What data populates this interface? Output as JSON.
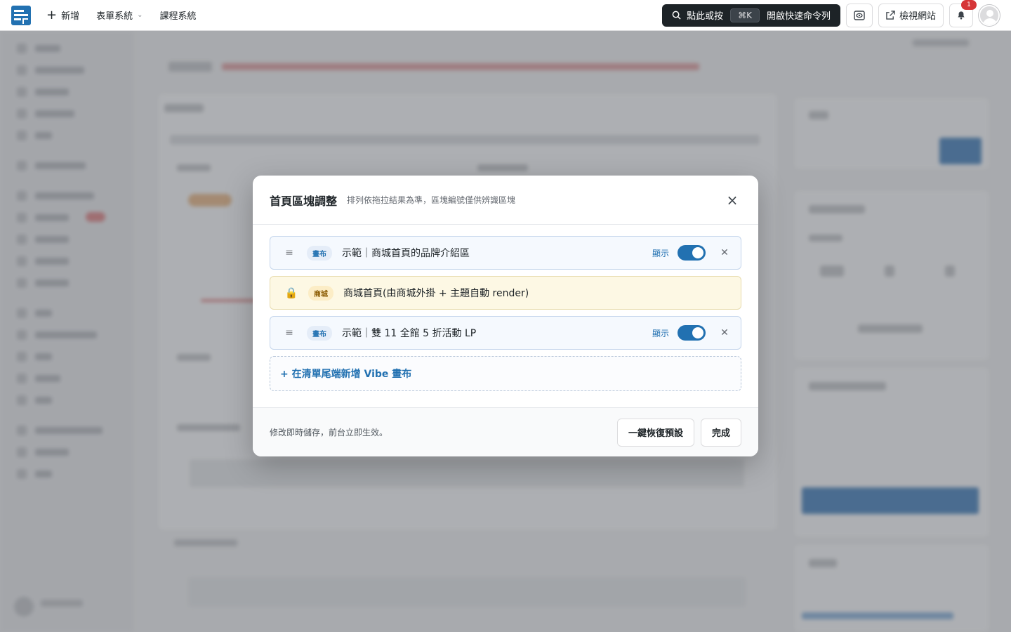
{
  "topbar": {
    "new_label": "新增",
    "forms_label": "表單系統",
    "courses_label": "課程系統",
    "command": {
      "prefix": "點此或按",
      "shortcut": "⌘K",
      "suffix": "開啟快速命令列"
    },
    "view_site_label": "檢視網站",
    "notification_count": "1"
  },
  "modal": {
    "title": "首頁區塊調整",
    "subtitle": "排列依拖拉結果為準，區塊編號僅供辨識區塊",
    "close_icon": "×",
    "rows": [
      {
        "tag": "畫布",
        "title": "示範｜商城首頁的品牌介紹區",
        "show_label": "顯示",
        "enabled": true,
        "locked": false
      },
      {
        "tag": "商城",
        "title": "商城首頁(由商城外掛 + 主題自動 render)",
        "locked": true
      },
      {
        "tag": "畫布",
        "title": "示範｜雙 11 全館 5 折活動 LP",
        "show_label": "顯示",
        "enabled": true,
        "locked": false
      }
    ],
    "add_label": "+ 在清單尾端新增 Vibe 畫布",
    "footer_note": "修改即時儲存，前台立即生效。",
    "reset_label": "一鍵恢復預設",
    "done_label": "完成"
  },
  "colors": {
    "accent": "#2271b1",
    "locked_bg": "#fdf8e4",
    "badge": "#d63638"
  }
}
